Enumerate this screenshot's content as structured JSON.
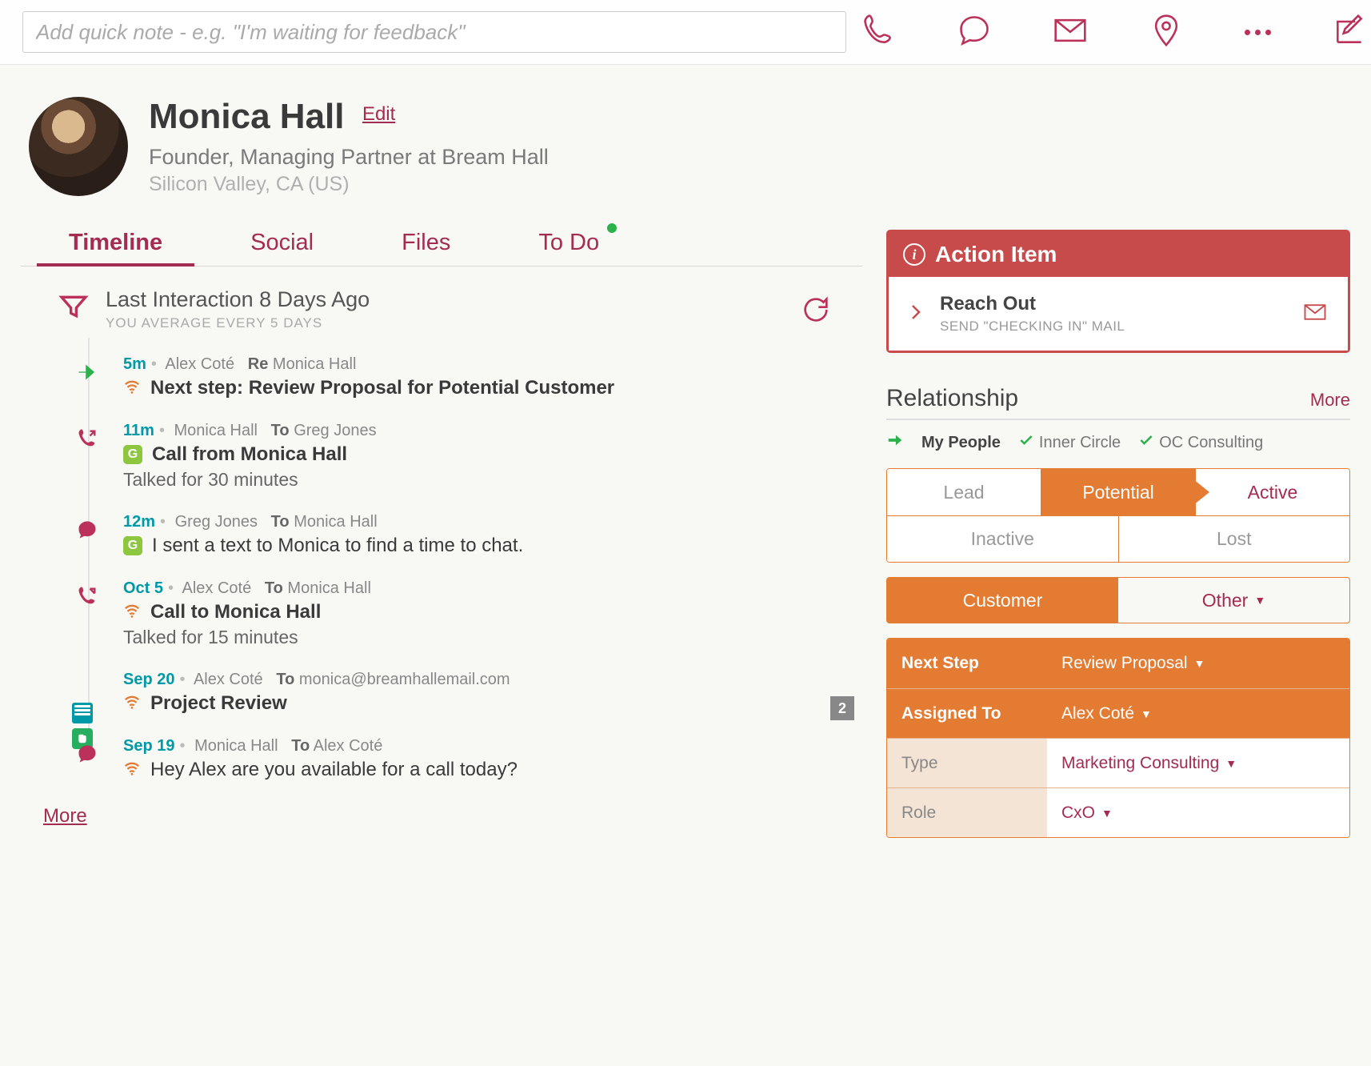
{
  "topbar": {
    "quicknote_placeholder": "Add quick note - e.g. \"I'm waiting for feedback\""
  },
  "person": {
    "name": "Monica Hall",
    "edit": "Edit",
    "title": "Founder, Managing Partner at Bream Hall",
    "location": "Silicon Valley, CA (US)"
  },
  "tabs": {
    "timeline": "Timeline",
    "social": "Social",
    "files": "Files",
    "todo": "To Do"
  },
  "interaction": {
    "last": "Last Interaction 8 Days Ago",
    "avg": "YOU AVERAGE EVERY 5 DAYS"
  },
  "timeline_items": [
    {
      "time": "5m",
      "who": "Alex Coté",
      "direction": "Re",
      "to": "Monica Hall",
      "title": "Next step: Review Proposal for Potential Customer",
      "icon": "arrow",
      "prefix": "wifi"
    },
    {
      "time": "11m",
      "who": "Monica Hall",
      "direction": "To",
      "to": "Greg Jones",
      "title": "Call from Monica Hall",
      "body": "Talked for 30 minutes",
      "icon": "call-in",
      "prefix": "green"
    },
    {
      "time": "12m",
      "who": "Greg Jones",
      "direction": "To",
      "to": "Monica Hall",
      "title": "I sent a text to Monica to find a time to chat.",
      "icon": "chat",
      "prefix": "green",
      "title_weight": "normal"
    },
    {
      "time": "Oct 5",
      "who": "Alex Coté",
      "direction": "To",
      "to": "Monica Hall",
      "title": "Call to Monica Hall",
      "body": "Talked for 15 minutes",
      "icon": "call-out",
      "prefix": "wifi"
    },
    {
      "time": "Sep 20",
      "who": "Alex Coté",
      "direction": "To",
      "to": "monica@breamhallemail.com",
      "title": "Project Review",
      "badge": "2",
      "icon": "calendar",
      "prefix": "wifi"
    },
    {
      "time": "Sep 19",
      "who": "Monica Hall",
      "direction": "To",
      "to": "Alex Coté",
      "title": "Hey Alex are you available for a call today?",
      "icon": "chat",
      "prefix": "wifi",
      "title_weight": "normal"
    }
  ],
  "more_label": "More",
  "action_item": {
    "header": "Action Item",
    "title": "Reach Out",
    "subtitle": "SEND \"CHECKING IN\" MAIL"
  },
  "relationship": {
    "header": "Relationship",
    "more": "More",
    "tags": {
      "my_people": "My People",
      "inner_circle": "Inner Circle",
      "oc": "OC Consulting"
    },
    "stages": {
      "lead": "Lead",
      "potential": "Potential",
      "active": "Active",
      "inactive": "Inactive",
      "lost": "Lost"
    },
    "type": {
      "customer": "Customer",
      "other": "Other"
    },
    "kv": {
      "next_step_k": "Next Step",
      "next_step_v": "Review Proposal",
      "assigned_k": "Assigned To",
      "assigned_v": "Alex Coté",
      "type_k": "Type",
      "type_v": "Marketing Consulting",
      "role_k": "Role",
      "role_v": "CxO"
    }
  }
}
